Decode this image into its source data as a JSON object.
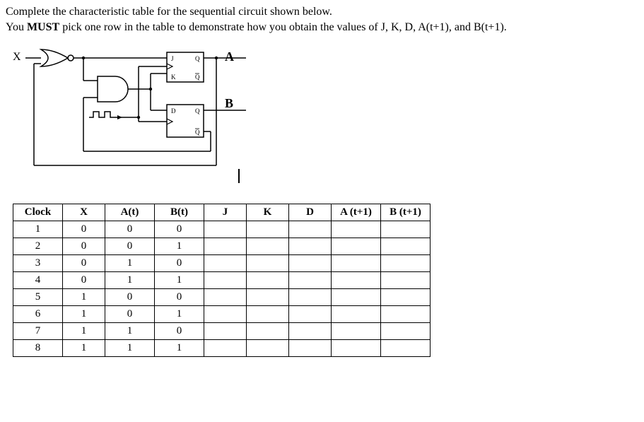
{
  "question": {
    "line1": "Complete the characteristic table for the sequential circuit shown below.",
    "line2a": "You ",
    "line2b": "MUST",
    "line2c": " pick one row in the table to demonstrate how you obtain the values of J, K, D, A(t+1), and B(t+1)."
  },
  "circuit": {
    "input_label": "X",
    "output_a": "A",
    "output_b": "B",
    "ff1": {
      "top_in": "J",
      "top_out": "Q",
      "bot_in": "K",
      "bot_out": "Q̄"
    },
    "ff2": {
      "top_in": "D",
      "top_out": "Q",
      "bot_out": "Q̄"
    }
  },
  "table": {
    "headers": [
      "Clock",
      "X",
      "A(t)",
      "B(t)",
      "J",
      "K",
      "D",
      "A (t+1)",
      "B (t+1)"
    ],
    "rows": [
      {
        "clock": "1",
        "x": "0",
        "at": "0",
        "bt": "0",
        "j": "",
        "k": "",
        "d": "",
        "at1": "",
        "bt1": ""
      },
      {
        "clock": "2",
        "x": "0",
        "at": "0",
        "bt": "1",
        "j": "",
        "k": "",
        "d": "",
        "at1": "",
        "bt1": ""
      },
      {
        "clock": "3",
        "x": "0",
        "at": "1",
        "bt": "0",
        "j": "",
        "k": "",
        "d": "",
        "at1": "",
        "bt1": ""
      },
      {
        "clock": "4",
        "x": "0",
        "at": "1",
        "bt": "1",
        "j": "",
        "k": "",
        "d": "",
        "at1": "",
        "bt1": ""
      },
      {
        "clock": "5",
        "x": "1",
        "at": "0",
        "bt": "0",
        "j": "",
        "k": "",
        "d": "",
        "at1": "",
        "bt1": ""
      },
      {
        "clock": "6",
        "x": "1",
        "at": "0",
        "bt": "1",
        "j": "",
        "k": "",
        "d": "",
        "at1": "",
        "bt1": ""
      },
      {
        "clock": "7",
        "x": "1",
        "at": "1",
        "bt": "0",
        "j": "",
        "k": "",
        "d": "",
        "at1": "",
        "bt1": ""
      },
      {
        "clock": "8",
        "x": "1",
        "at": "1",
        "bt": "1",
        "j": "",
        "k": "",
        "d": "",
        "at1": "",
        "bt1": ""
      }
    ]
  }
}
